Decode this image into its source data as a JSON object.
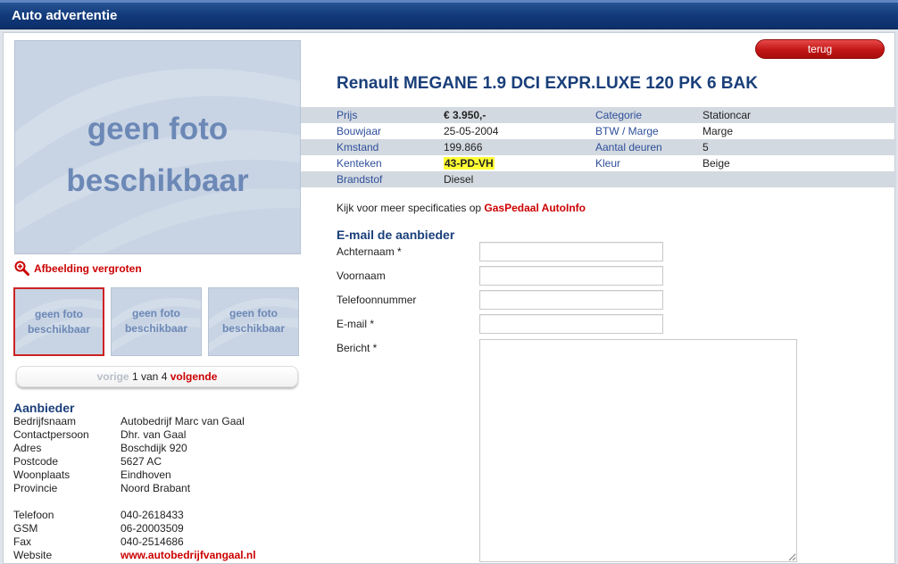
{
  "header": {
    "title": "Auto advertentie"
  },
  "photo": {
    "placeholder_line1": "geen foto",
    "placeholder_line2": "beschikbaar",
    "enlarge_label": "Afbeelding vergroten",
    "enlarge_icon": "zoom-in-icon"
  },
  "thumbnails": [
    {
      "line1": "geen foto",
      "line2": "beschikbaar"
    },
    {
      "line1": "geen foto",
      "line2": "beschikbaar"
    },
    {
      "line1": "geen foto",
      "line2": "beschikbaar"
    }
  ],
  "pager": {
    "prev": "vorige",
    "current": "1",
    "of_label": "van",
    "total": "4",
    "next": "volgende"
  },
  "provider": {
    "title": "Aanbieder",
    "rows": [
      {
        "label": "Bedrijfsnaam",
        "value": "Autobedrijf Marc van Gaal"
      },
      {
        "label": "Contactpersoon",
        "value": "Dhr. van Gaal"
      },
      {
        "label": "Adres",
        "value": "Boschdijk 920"
      },
      {
        "label": "Postcode",
        "value": "5627 AC"
      },
      {
        "label": "Woonplaats",
        "value": "Eindhoven"
      },
      {
        "label": "Provincie",
        "value": "Noord Brabant"
      }
    ],
    "contact_rows": [
      {
        "label": "Telefoon",
        "value": "040-2618433"
      },
      {
        "label": "GSM",
        "value": "06-20003509"
      },
      {
        "label": "Fax",
        "value": "040-2514686"
      },
      {
        "label": "Website",
        "value": "www.autobedrijfvangaal.nl"
      }
    ]
  },
  "back_button": "terug",
  "car": {
    "title": "Renault MEGANE 1.9 DCI EXPR.LUXE 120 PK 6 BAK",
    "specs": [
      {
        "k1": "Prijs",
        "v1": "€ 3.950,-",
        "k2": "Categorie",
        "v2": "Stationcar"
      },
      {
        "k1": "Bouwjaar",
        "v1": "25-05-2004",
        "k2": "BTW / Marge",
        "v2": "Marge"
      },
      {
        "k1": "Kmstand",
        "v1": "199.866",
        "k2": "Aantal deuren",
        "v2": "5"
      },
      {
        "k1": "Kenteken",
        "v1": "43-PD-VH",
        "k2": "Kleur",
        "v2": "Beige"
      },
      {
        "k1": "Brandstof",
        "v1": "Diesel",
        "k2": "",
        "v2": ""
      }
    ]
  },
  "more_info": {
    "text": "Kijk voor meer specificaties op ",
    "link": "GasPedaal AutoInfo"
  },
  "email_form": {
    "title": "E-mail de aanbieder",
    "fields": {
      "achternaam": {
        "label": "Achternaam *",
        "value": ""
      },
      "voornaam": {
        "label": "Voornaam",
        "value": ""
      },
      "telefoonnummer": {
        "label": "Telefoonnummer",
        "value": ""
      },
      "email": {
        "label": "E-mail *",
        "value": ""
      },
      "bericht": {
        "label": "Bericht *",
        "value": ""
      }
    }
  },
  "colors": {
    "header_blue": "#12397a",
    "title_blue": "#1a3f7a",
    "label_blue": "#2d4f9a",
    "accent_red": "#cc0000",
    "plate_yellow": "#ffff33"
  }
}
